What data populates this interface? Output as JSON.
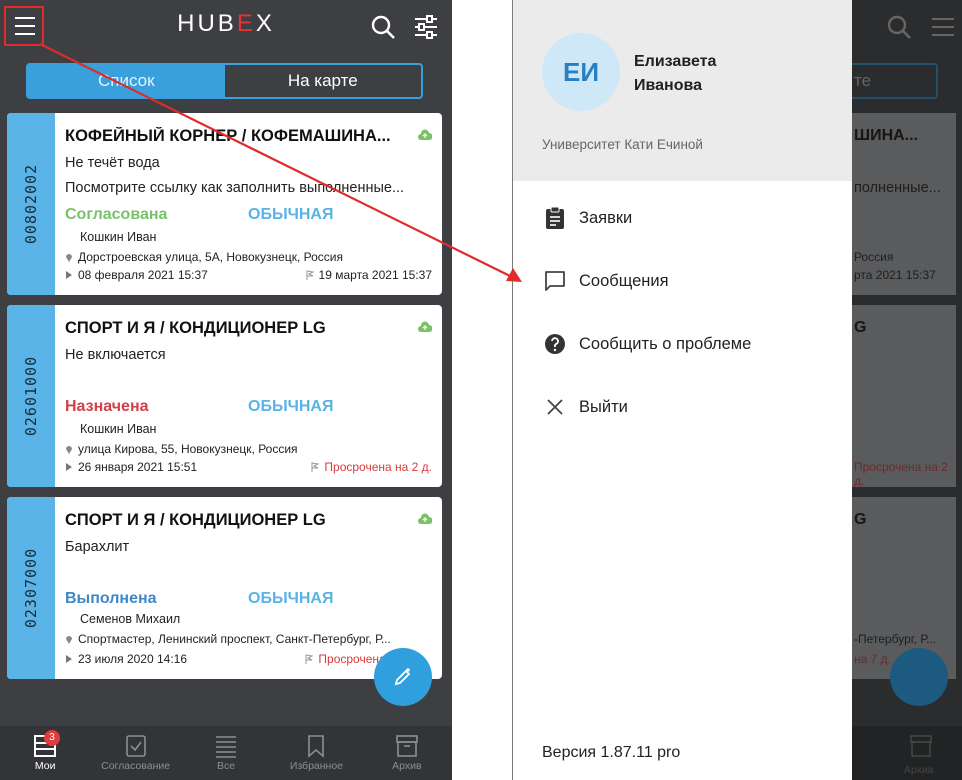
{
  "left_screen": {
    "app_logo": {
      "part1": "HUB",
      "part2": "E",
      "part3": "X"
    },
    "tabs": {
      "list": "Список",
      "map": "На карте"
    },
    "cards": [
      {
        "number": "00802002",
        "title": "КОФЕЙНЫЙ КОРНЕР / КОФЕМАШИНА...",
        "desc1": "Не течёт вода",
        "desc2": "Посмотрите ссылку как заполнить выполненные...",
        "status": "Согласована",
        "status_color": "#78c26a",
        "priority": "ОБЫЧНАЯ",
        "person": "Кошкин Иван",
        "address": "Дорстроевская улица, 5А, Новокузнецк, Россия",
        "start": "08 февраля 2021 15:37",
        "end": "19 марта 2021 15:37",
        "overdue": false
      },
      {
        "number": "02601000",
        "title": "СПОРТ И Я / КОНДИЦИОНЕР LG",
        "desc1": "Не включается",
        "desc2": "",
        "status": "Назначена",
        "status_color": "#d2404a",
        "priority": "ОБЫЧНАЯ",
        "person": "Кошкин Иван",
        "address": "улица Кирова, 55, Новокузнецк, Россия",
        "start": "26 января 2021 15:51",
        "end": "Просрочена на 2 д.",
        "overdue": true
      },
      {
        "number": "02307000",
        "title": "СПОРТ И Я / КОНДИЦИОНЕР LG",
        "desc1": "Барахлит",
        "desc2": "",
        "status": "Выполнена",
        "status_color": "#3f88c5",
        "priority": "ОБЫЧНАЯ",
        "person": "Семенов Михаил",
        "address": "Спортмастер, Ленинский проспект, Санкт-Петербург, Р...",
        "start": "23 июля 2020 14:16",
        "end": "Просрочена на 7 д.",
        "overdue": true
      }
    ],
    "bottom_nav": [
      {
        "label": "Мои",
        "icon": "inbox-icon",
        "badge": "3"
      },
      {
        "label": "Согласование",
        "icon": "approval-icon"
      },
      {
        "label": "Все",
        "icon": "list-icon"
      },
      {
        "label": "Избранное",
        "icon": "bookmark-icon"
      },
      {
        "label": "Архив",
        "icon": "archive-icon"
      }
    ]
  },
  "drawer": {
    "avatar_initials": "ЕИ",
    "user_first": "Елизавета",
    "user_last": "Иванова",
    "organization": "Университет Кати Ечиной",
    "items": [
      {
        "label": "Заявки",
        "icon": "clipboard-icon"
      },
      {
        "label": "Сообщения",
        "icon": "message-icon"
      },
      {
        "label": "Сообщить о проблеме",
        "icon": "help-icon"
      },
      {
        "label": "Выйти",
        "icon": "close-icon"
      }
    ],
    "version": "Версия 1.87.11 pro"
  },
  "right_bg": {
    "tab_partial": "те",
    "card1_title_partial": "ШИНА...",
    "card1_desc_partial": "полненные...",
    "card1_addr_partial": "Россия",
    "card1_end_partial": "рта 2021 15:37",
    "card2_title_partial": "G",
    "card2_end_partial": "Просрочена на 2 д.",
    "card3_title_partial": "G",
    "card3_addr_partial": "-Петербург, Р...",
    "card3_end_partial": "на 7 д.",
    "nav_partial": "Архив"
  },
  "colors": {
    "accent": "#3aa0dc",
    "annotation": "#e02b2b"
  }
}
